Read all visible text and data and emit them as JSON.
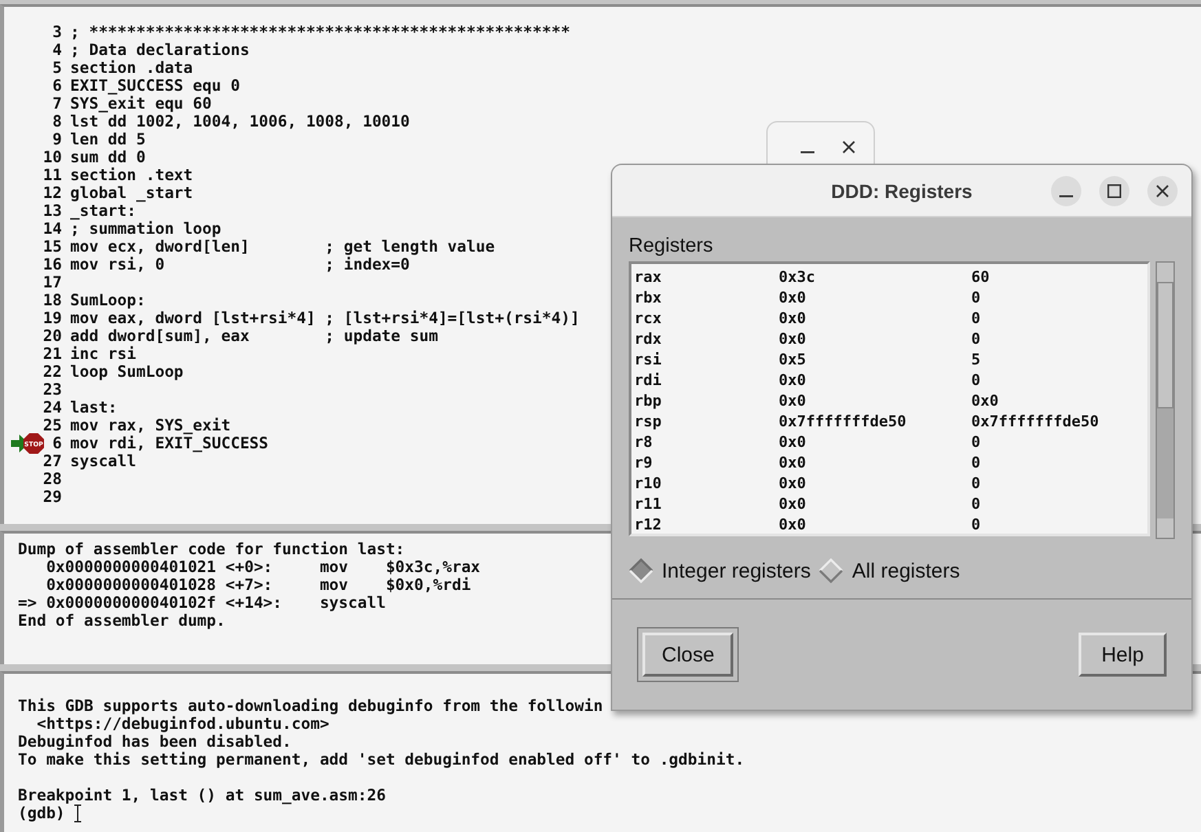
{
  "source": {
    "lines": [
      {
        "num": "3",
        "code": "; ***************************************************"
      },
      {
        "num": "4",
        "code": "; Data declarations"
      },
      {
        "num": "5",
        "code": "section .data"
      },
      {
        "num": "6",
        "code": "EXIT_SUCCESS equ 0"
      },
      {
        "num": "7",
        "code": "SYS_exit equ 60"
      },
      {
        "num": "8",
        "code": "lst dd 1002, 1004, 1006, 1008, 10010"
      },
      {
        "num": "9",
        "code": "len dd 5"
      },
      {
        "num": "10",
        "code": "sum dd 0"
      },
      {
        "num": "11",
        "code": "section .text"
      },
      {
        "num": "12",
        "code": "global _start"
      },
      {
        "num": "13",
        "code": "_start:"
      },
      {
        "num": "14",
        "code": "; summation loop"
      },
      {
        "num": "15",
        "code": "mov ecx, dword[len]        ; get length value"
      },
      {
        "num": "16",
        "code": "mov rsi, 0                 ; index=0"
      },
      {
        "num": "17"
      },
      {
        "num": "18",
        "code": "SumLoop:"
      },
      {
        "num": "19",
        "code": "mov eax, dword [lst+rsi*4] ; [lst+rsi*4]=[lst+(rsi*4)]"
      },
      {
        "num": "20",
        "code": "add dword[sum], eax        ; update sum"
      },
      {
        "num": "21",
        "code": "inc rsi"
      },
      {
        "num": "22",
        "code": "loop SumLoop"
      },
      {
        "num": "23"
      },
      {
        "num": "24",
        "code": "last:"
      },
      {
        "num": "25",
        "code": "mov rax, SYS_exit"
      },
      {
        "num": "6",
        "code": "mov rdi, EXIT_SUCCESS",
        "breakpoint": true,
        "breakpoint_label": "STOP",
        "current": true
      },
      {
        "num": "27",
        "code": "syscall"
      },
      {
        "num": "28"
      },
      {
        "num": "29"
      }
    ]
  },
  "assembler": {
    "lines": [
      "Dump of assembler code for function last:",
      "   0x0000000000401021 <+0>:     mov    $0x3c,%rax",
      "   0x0000000000401028 <+7>:     mov    $0x0,%rdi",
      "=> 0x000000000040102f <+14>:    syscall",
      "End of assembler dump."
    ]
  },
  "console": {
    "paragraphs": [
      [
        "This GDB supports auto-downloading debuginfo from the followin",
        "  <https://debuginfod.ubuntu.com>",
        "Debuginfod has been disabled.",
        "To make this setting permanent, add 'set debuginfod enabled off' to .gdbinit."
      ],
      [
        "Breakpoint 1, last () at sum_ave.asm:26",
        "(gdb)"
      ]
    ]
  },
  "registers_dialog": {
    "title": "DDD: Registers",
    "label": "Registers",
    "rows": [
      {
        "name": "rax",
        "hex": "0x3c",
        "natural": "60"
      },
      {
        "name": "rbx",
        "hex": "0x0",
        "natural": "0"
      },
      {
        "name": "rcx",
        "hex": "0x0",
        "natural": "0"
      },
      {
        "name": "rdx",
        "hex": "0x0",
        "natural": "0"
      },
      {
        "name": "rsi",
        "hex": "0x5",
        "natural": "5"
      },
      {
        "name": "rdi",
        "hex": "0x0",
        "natural": "0"
      },
      {
        "name": "rbp",
        "hex": "0x0",
        "natural": "0x0"
      },
      {
        "name": "rsp",
        "hex": "0x7fffffffde50",
        "natural": "0x7fffffffde50"
      },
      {
        "name": "r8",
        "hex": "0x0",
        "natural": "0"
      },
      {
        "name": "r9",
        "hex": "0x0",
        "natural": "0"
      },
      {
        "name": "r10",
        "hex": "0x0",
        "natural": "0"
      },
      {
        "name": "r11",
        "hex": "0x0",
        "natural": "0"
      },
      {
        "name": "r12",
        "hex": "0x0",
        "natural": "0"
      }
    ],
    "options": [
      {
        "label": "Integer registers",
        "selected": true
      },
      {
        "label": "All registers",
        "selected": false
      }
    ],
    "buttons": [
      "Close",
      "Help"
    ]
  }
}
